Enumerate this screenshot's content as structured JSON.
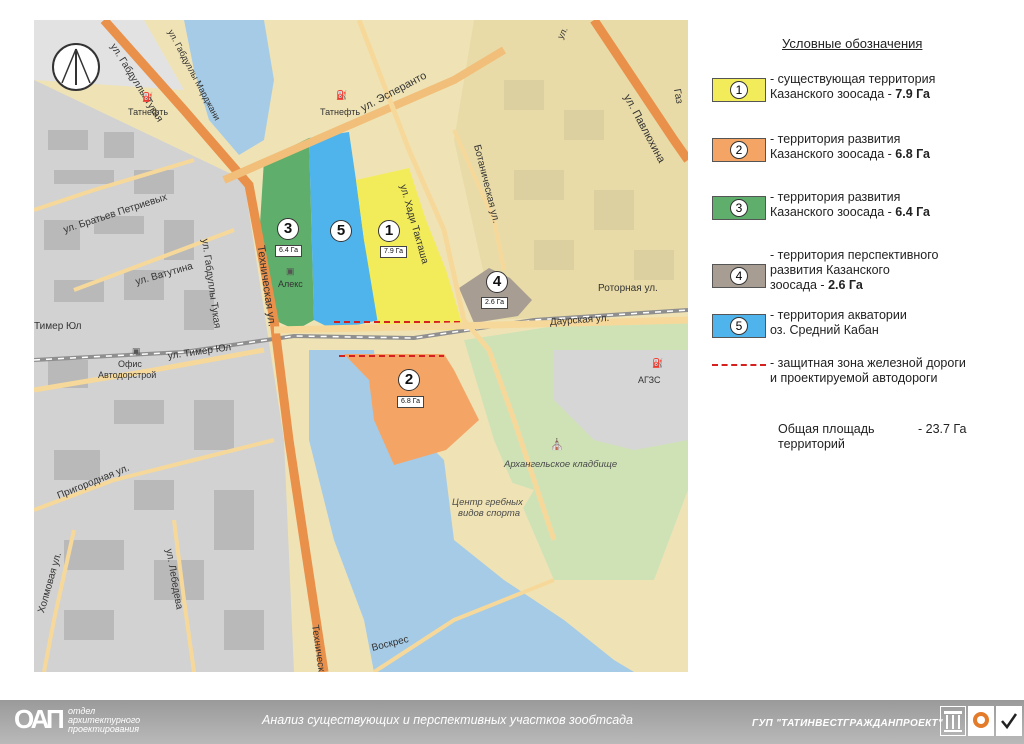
{
  "map": {
    "streets": {
      "tukaya_top": "ул. Габдуллы Тукая",
      "mardzhani": "ул. Габдуллы Марджани",
      "esperanto": "ул. Эсперанто",
      "pavlyukhina": "ул. Павлюхина",
      "gaz": "Газ",
      "ul_top": "ул.",
      "bratev_petrievykh": "ул. Братьев Петриевых",
      "vatutina": "ул. Ватутина",
      "tukaya_mid": "ул. Габдуллы Тукая",
      "tekhnicheskaya": "Техническая ул.",
      "khadi_taktasha": "ул. Хади Такташа",
      "botanicheskaya": "Ботаническая ул.",
      "rotornaya": "Роторная ул.",
      "daurskaya": "Даурская ул.",
      "timer_yul": "ул. Тимер Юл",
      "timer_yul_left": "Тимер Юл",
      "prigorodnaya": "Пригородная ул.",
      "kholmovaya": "Холмовая ул.",
      "lebedeva": "ул. Лебедева",
      "tekhnichesk_bottom": "Техническ",
      "voskres": "Воскрес"
    },
    "pois": {
      "tatneft_left": "Татнефть",
      "tatneft_top": "Татнефть",
      "aleks": "Алекс",
      "ofis_line1": "Офис",
      "ofis_line2": "Автодорстрой",
      "agzs": "АГЗС",
      "cemetery": "Архангельское кладбище",
      "rowing_line1": "Центр гребных",
      "rowing_line2": "видов спорта"
    },
    "zones": [
      {
        "num": "1",
        "area": "7.9 Га"
      },
      {
        "num": "2",
        "area": "6.8 Га"
      },
      {
        "num": "3",
        "area": "6.4 Га"
      },
      {
        "num": "4",
        "area": "2.6 Га"
      },
      {
        "num": "5"
      }
    ]
  },
  "legend": {
    "title": "Условные обозначения",
    "items": [
      {
        "num": "1",
        "color": "#f3ec5a",
        "line1": "- существующая территория",
        "line2": "Казанского зоосада - ",
        "value": "7.9 Га"
      },
      {
        "num": "2",
        "color": "#f4a566",
        "line1": "- территория развития",
        "line2": "Казанского зоосада - ",
        "value": "6.8 Га"
      },
      {
        "num": "3",
        "color": "#5fae6b",
        "line1": "- территория развития",
        "line2": "Казанского зоосада - ",
        "value": "6.4 Га"
      },
      {
        "num": "4",
        "color": "#a79d92",
        "line1": "- территория перспективного",
        "line2": "развития Казанского",
        "line3": "зоосада - ",
        "value": "2.6 Га"
      },
      {
        "num": "5",
        "color": "#4fb4ec",
        "line1": "- территория акватории",
        "line2": "оз. Средний Кабан"
      }
    ],
    "protect": {
      "color": "#d62020",
      "line1": "- защитная зона железной дороги",
      "line2": "и проектируемой автодороги"
    },
    "total": {
      "line1": "Общая площадь",
      "line2": "территорий",
      "value": "- 23.7 Га"
    }
  },
  "footer": {
    "logo": "ОАП",
    "logo_sub1": "отдел",
    "logo_sub2": "архитектурного",
    "logo_sub3": "проектирования",
    "title": "Анализ существующих и перспективных участков зообтсада",
    "org": "ГУП \"ТАТИНВЕСТГРАЖДАНПРОЕКТ\""
  },
  "colors": {
    "water": "#a6cbe6",
    "land": "#efe3b5",
    "road_major": "#e9904a",
    "zone1": "#f3ec5a",
    "zone2": "#f4a566",
    "zone3": "#5fae6b",
    "zone4": "#a79d92",
    "zone5": "#4fb4ec"
  }
}
